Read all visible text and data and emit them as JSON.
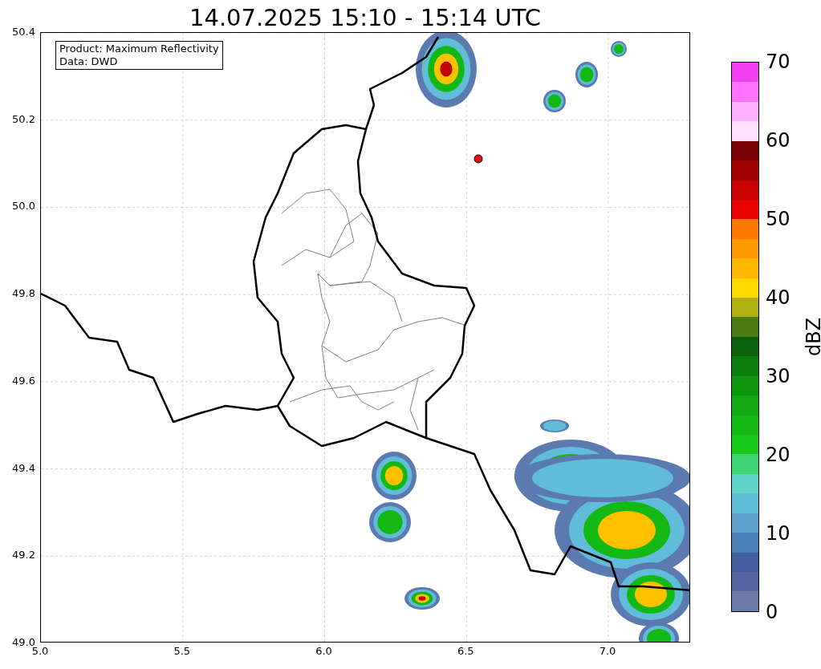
{
  "title": "14.07.2025 15:10 - 15:14 UTC",
  "legend": [
    "Product: Maximum Reflectivity",
    "Data: DWD"
  ],
  "axes": {
    "xticks": [
      "5.0",
      "5.5",
      "6.0",
      "6.5",
      "7.0"
    ],
    "yticks": [
      "50.4",
      "50.2",
      "50.0",
      "49.8",
      "49.6",
      "49.4",
      "49.2",
      "49.0"
    ]
  },
  "colorbar": {
    "label": "dBZ",
    "ticks": [
      "70",
      "60",
      "50",
      "40",
      "30",
      "20",
      "10",
      "0"
    ],
    "segments": [
      {
        "color": "#f040f0"
      },
      {
        "color": "#ff70ff"
      },
      {
        "color": "#ffb0ff"
      },
      {
        "color": "#ffe0ff"
      },
      {
        "color": "#780000"
      },
      {
        "color": "#a00000"
      },
      {
        "color": "#c80000"
      },
      {
        "color": "#e80000"
      },
      {
        "color": "#ff7800"
      },
      {
        "color": "#ff9800"
      },
      {
        "color": "#ffb800"
      },
      {
        "color": "#ffd800"
      },
      {
        "color": "#b0b010"
      },
      {
        "color": "#4a7a10"
      },
      {
        "color": "#0a600a"
      },
      {
        "color": "#0c7d0c"
      },
      {
        "color": "#0e960e"
      },
      {
        "color": "#10a810"
      },
      {
        "color": "#14b814"
      },
      {
        "color": "#18c818"
      },
      {
        "color": "#40d470"
      },
      {
        "color": "#60d4c8"
      },
      {
        "color": "#60bcd8"
      },
      {
        "color": "#5aa0c8"
      },
      {
        "color": "#4a80b8"
      },
      {
        "color": "#4560a0"
      },
      {
        "color": "#5566a0"
      },
      {
        "color": "#6b7aa8"
      }
    ]
  }
}
